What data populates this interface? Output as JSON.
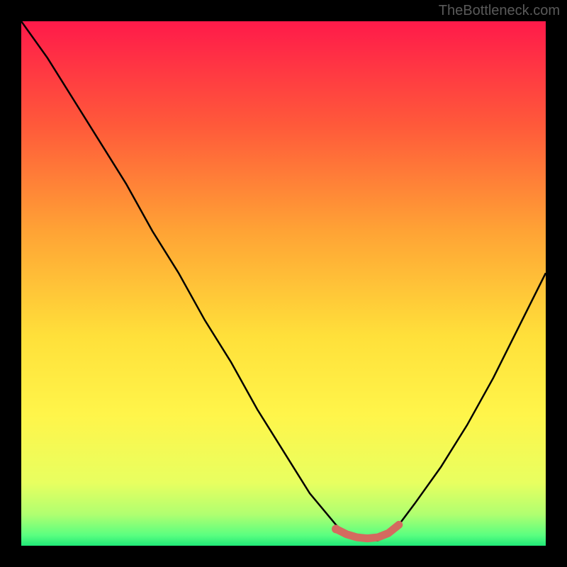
{
  "watermark": "TheBottleneck.com",
  "chart_data": {
    "type": "line",
    "title": "",
    "xlabel": "",
    "ylabel": "",
    "xlim": [
      0,
      100
    ],
    "ylim": [
      0,
      100
    ],
    "curve": {
      "name": "bottleneck-curve",
      "color": "#000000",
      "x": [
        0,
        5,
        10,
        15,
        20,
        25,
        30,
        35,
        40,
        45,
        50,
        55,
        60,
        62,
        65,
        68,
        70,
        72,
        75,
        80,
        85,
        90,
        95,
        100
      ],
      "y": [
        100,
        93,
        85,
        77,
        69,
        60,
        52,
        43,
        35,
        26,
        18,
        10,
        4,
        2,
        1,
        1,
        2,
        4,
        8,
        15,
        23,
        32,
        42,
        52
      ]
    },
    "plateau_marker": {
      "name": "optimal-range",
      "color": "#d46a5f",
      "x": [
        60,
        62,
        64,
        66,
        68,
        70,
        72
      ],
      "y": [
        3.2,
        2.2,
        1.6,
        1.4,
        1.6,
        2.4,
        4.0
      ]
    },
    "gradient_stops": [
      {
        "offset": 0,
        "color": "#ff1a4a"
      },
      {
        "offset": 20,
        "color": "#ff5a3a"
      },
      {
        "offset": 40,
        "color": "#ffa335"
      },
      {
        "offset": 60,
        "color": "#ffe03a"
      },
      {
        "offset": 75,
        "color": "#fff54a"
      },
      {
        "offset": 88,
        "color": "#e8ff60"
      },
      {
        "offset": 94,
        "color": "#b0ff70"
      },
      {
        "offset": 98,
        "color": "#5aff80"
      },
      {
        "offset": 100,
        "color": "#20e878"
      }
    ]
  }
}
